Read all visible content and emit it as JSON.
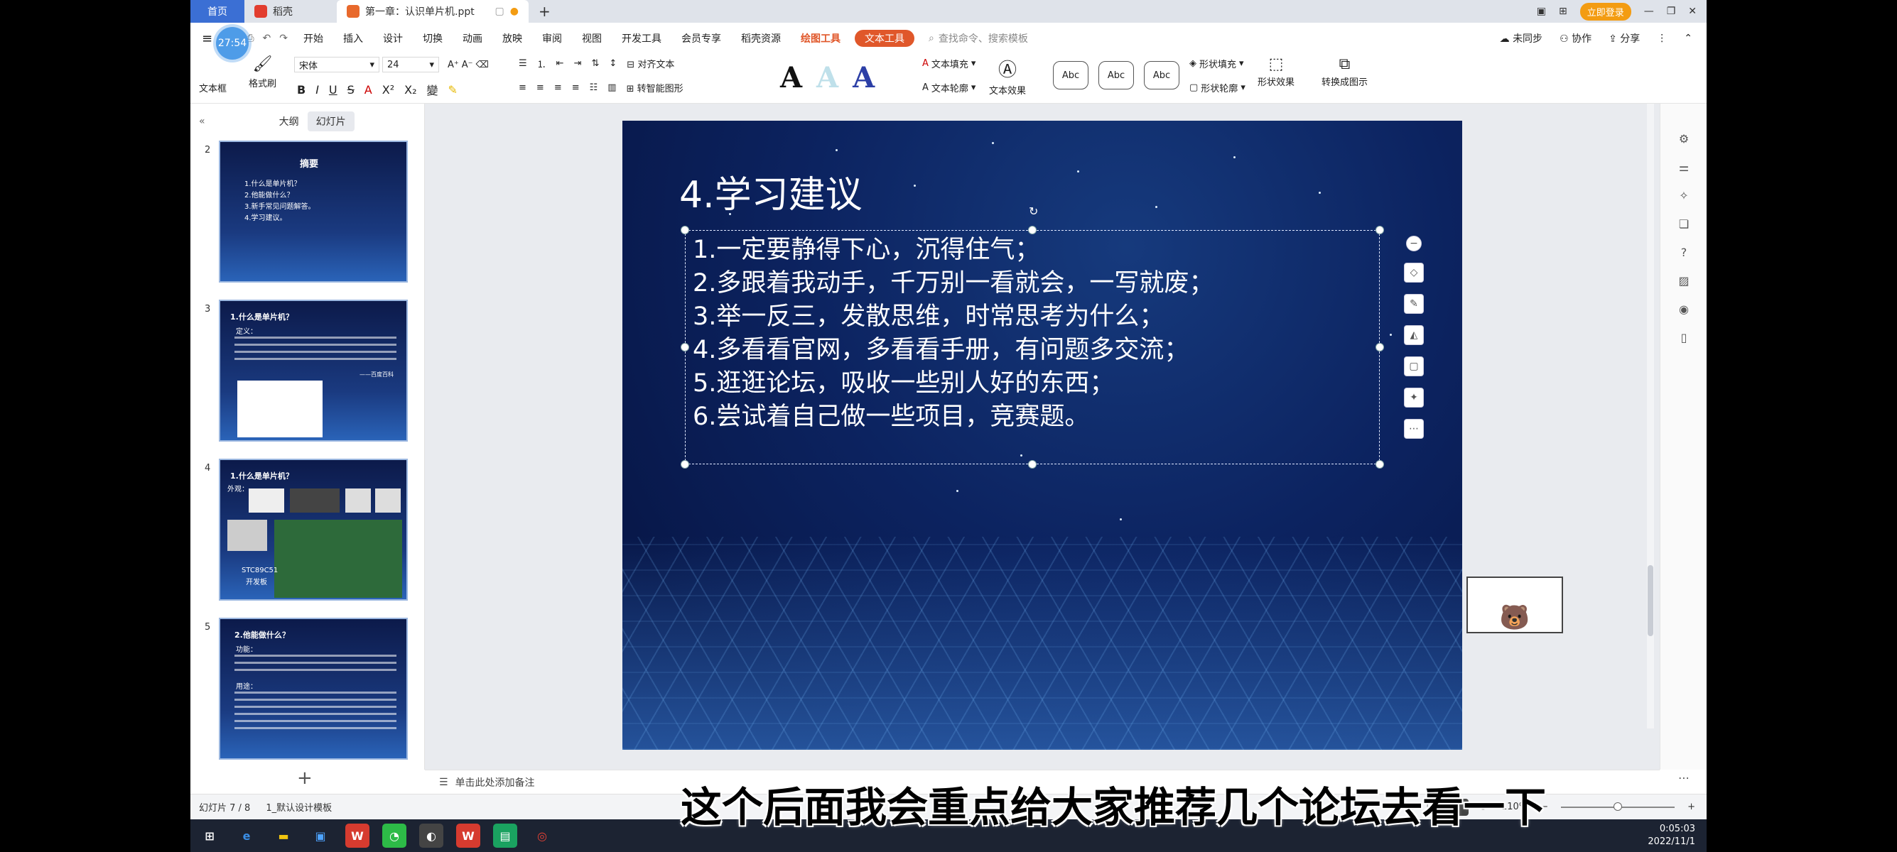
{
  "titlebar": {
    "home_tab": "首页",
    "app_tab": "稻壳",
    "doc_tab": "第一章：认识单片机.ppt",
    "new_tab": "+",
    "login": "立即登录"
  },
  "menubar": {
    "items": [
      "开始",
      "插入",
      "设计",
      "切换",
      "动画",
      "放映",
      "审阅",
      "视图",
      "开发工具",
      "会员专享",
      "稻壳资源"
    ],
    "context_tools": "绘图工具",
    "active_tool": "文本工具",
    "search_placeholder": "查找命令、搜索模板",
    "sync": "未同步",
    "collab": "协作",
    "share": "分享"
  },
  "ribbon": {
    "timer": "27:54",
    "textbox": "文本框",
    "format_painter": "格式刷",
    "font_name": "宋体",
    "font_size": "24",
    "align_text": "对齐文本",
    "smartart": "转智能图形",
    "text_fill": "文本填充",
    "text_outline": "文本轮廓",
    "text_effect": "文本效果",
    "abc1": "Abc",
    "abc2": "Abc",
    "abc3": "Abc",
    "shape_fill": "形状填充",
    "shape_outline": "形状轮廓",
    "shape_effect": "形状效果",
    "convert": "转换成图示",
    "bigA": "A"
  },
  "left_panel": {
    "tab_outline": "大纲",
    "tab_slides": "幻灯片",
    "thumbnails": [
      {
        "num": "2",
        "title": "摘要",
        "lines": [
          "1.什么是单片机？",
          "2.他能做什么？",
          "3.新手常见问题解答。",
          "4.学习建议。"
        ]
      },
      {
        "num": "3",
        "title": "1.什么是单片机？",
        "lines": [
          "定义：",
          "——百度百科"
        ]
      },
      {
        "num": "4",
        "title": "1.什么是单片机？",
        "lines": [
          "外观：",
          "STC89C51",
          "开发板"
        ]
      },
      {
        "num": "5",
        "title": "2.他能做什么？",
        "lines": [
          "功能：",
          "用途："
        ]
      }
    ],
    "add": "+"
  },
  "slide": {
    "title": "4.学习建议",
    "items": [
      "1.一定要静得下心，沉得住气；",
      "2.多跟着我动手，千万别一看就会，一写就废；",
      "3.举一反三，发散思维，时常思考为什么；",
      "4.多看看官网，多看看手册，有问题多交流；",
      "5.逛逛论坛，吸收一些别人好的东西；",
      "6.尝试着自己做一些项目，竞赛题。"
    ]
  },
  "notes": {
    "placeholder": "单击此处添加备注"
  },
  "statusbar": {
    "slide_counter": "幻灯片 7 / 8",
    "theme": "1_默认设计模板",
    "zoom": "110%",
    "minus": "−",
    "plus": "+"
  },
  "taskbar": {
    "time": "0:05:03",
    "date": "2022/11/1"
  },
  "subtitle": "这个后面我会重点给大家推荐几个论坛去看一下"
}
